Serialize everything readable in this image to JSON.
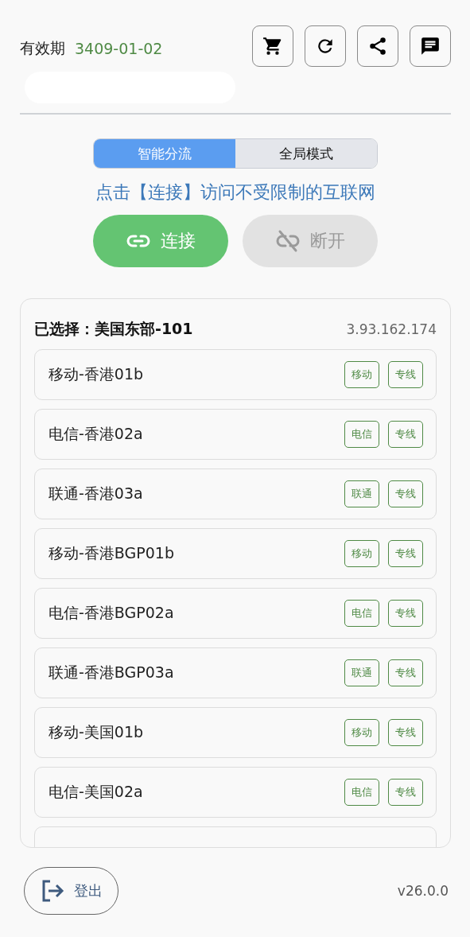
{
  "header": {
    "expiry_label": "有效期",
    "expiry_date": "3409-01-02",
    "actions": [
      {
        "kind": "cart"
      },
      {
        "kind": "refresh"
      },
      {
        "kind": "share"
      },
      {
        "kind": "message"
      }
    ]
  },
  "mode_tabs": [
    {
      "label": "智能分流",
      "selected": true
    },
    {
      "label": "全局模式",
      "selected": false
    }
  ],
  "hint": "点击【连接】访问不受限制的互联网",
  "connection_buttons": [
    {
      "kind": "connect",
      "label": "连接",
      "disabled": false
    },
    {
      "kind": "disconnect",
      "label": "断开",
      "disabled": true
    }
  ],
  "server_panel": {
    "selected_label": "已选择：美国东部-101",
    "ip": "3.93.162.174",
    "servers": [
      {
        "name": "移动-香港01b",
        "tags": [
          "移动",
          "专线"
        ]
      },
      {
        "name": "电信-香港02a",
        "tags": [
          "电信",
          "专线"
        ]
      },
      {
        "name": "联通-香港03a",
        "tags": [
          "联通",
          "专线"
        ]
      },
      {
        "name": "移动-香港BGP01b",
        "tags": [
          "移动",
          "专线"
        ]
      },
      {
        "name": "电信-香港BGP02a",
        "tags": [
          "电信",
          "专线"
        ]
      },
      {
        "name": "联通-香港BGP03a",
        "tags": [
          "联通",
          "专线"
        ]
      },
      {
        "name": "移动-美国01b",
        "tags": [
          "移动",
          "专线"
        ]
      },
      {
        "name": "电信-美国02a",
        "tags": [
          "电信",
          "专线"
        ]
      }
    ]
  },
  "footer": {
    "logout_label": "登出",
    "version": "v26.0.0"
  }
}
